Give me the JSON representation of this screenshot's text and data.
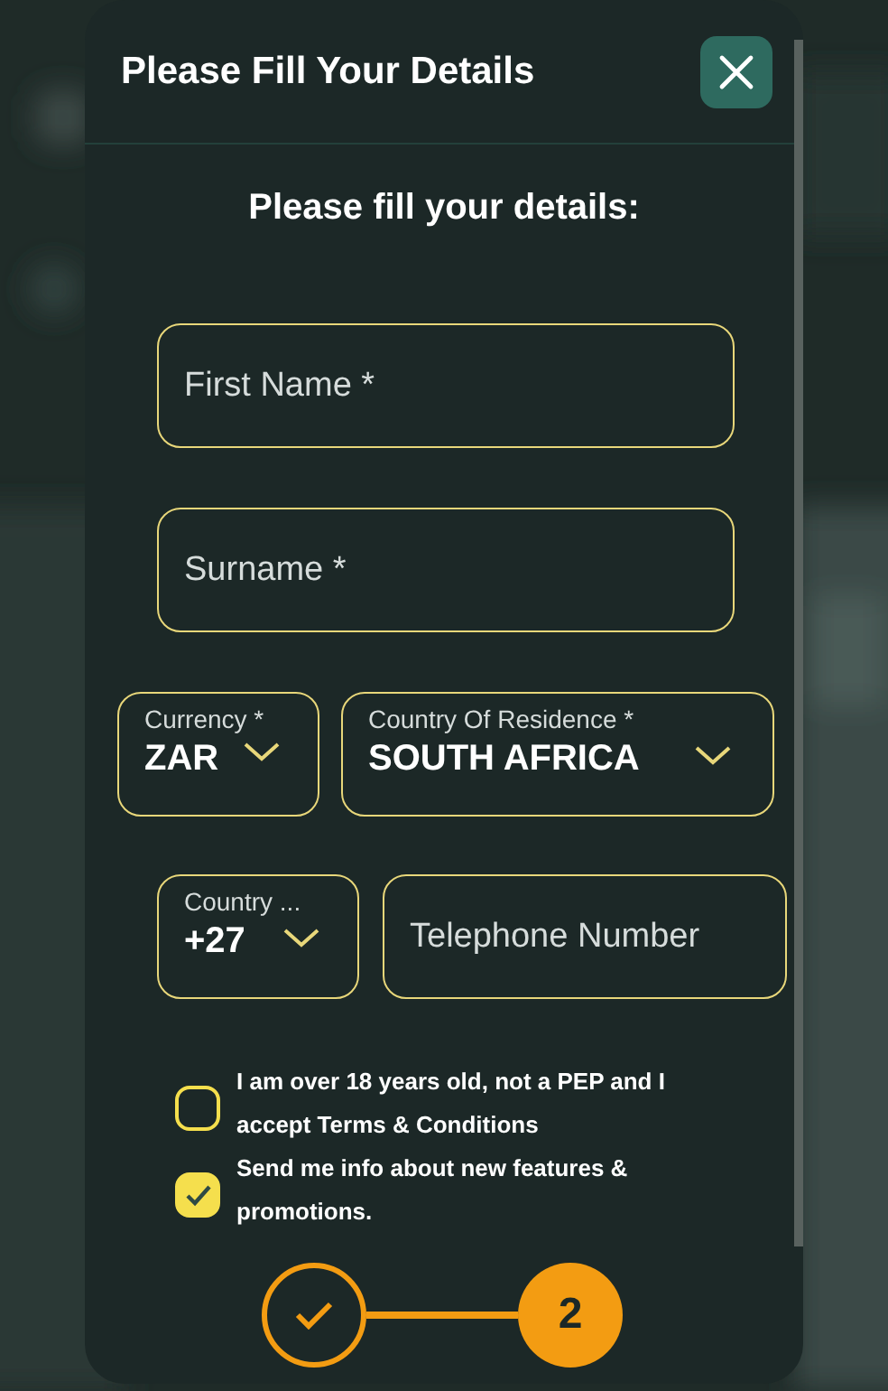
{
  "dialog": {
    "title": "Please Fill Your Details",
    "heading": "Please fill your details:"
  },
  "name_fields": [
    {
      "placeholder": "First Name *"
    },
    {
      "placeholder": "Surname *"
    }
  ],
  "selects": [
    {
      "label": "Currency *",
      "value": "ZAR"
    },
    {
      "label": "Country Of Residence *",
      "value": "SOUTH AFRICA"
    }
  ],
  "phone": {
    "code": {
      "label": "Country ...",
      "value": "+27"
    },
    "telephone": {
      "placeholder": "Telephone Number"
    }
  },
  "checkboxes": [
    {
      "label": "I am over 18 years old, not a PEP and I accept Terms & Conditions",
      "checked": false
    },
    {
      "label": "Send me info about new features & promotions.",
      "checked": true
    }
  ],
  "steps": [
    {
      "kind": "done"
    },
    {
      "kind": "current",
      "label": "2"
    }
  ]
}
